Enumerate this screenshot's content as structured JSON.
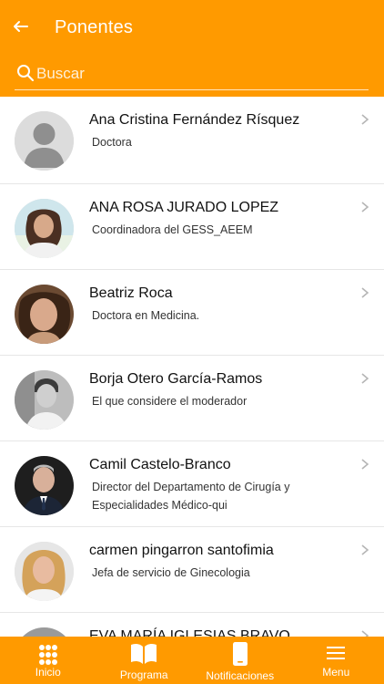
{
  "header": {
    "title": "Ponentes",
    "search_placeholder": "Buscar",
    "color": "#ff9a00"
  },
  "speakers": [
    {
      "name": "Ana Cristina Fernández Rísquez",
      "role": "Doctora",
      "avatar": "default-avatar"
    },
    {
      "name": "ANA ROSA JURADO LOPEZ",
      "role": "Coordinadora del GESS_AEEM",
      "avatar": "photo"
    },
    {
      "name": "Beatriz Roca",
      "role": "Doctora en Medicina.",
      "avatar": "photo"
    },
    {
      "name": "Borja Otero García-Ramos",
      "role": "El que considere el moderador",
      "avatar": "photo"
    },
    {
      "name": "Camil Castelo-Branco",
      "role": "Director del Departamento de Cirugía y Especialidades Médico-qui",
      "avatar": "photo"
    },
    {
      "name": "carmen pingarron santofimia",
      "role": "Jefa de servicio de Ginecologia",
      "avatar": "photo"
    },
    {
      "name": "EVA MARÍA IGLESIAS BRAVO",
      "role": "",
      "avatar": "photo"
    }
  ],
  "tabbar": {
    "tabs": [
      {
        "label": "Inicio",
        "icon": "grid-icon"
      },
      {
        "label": "Programa",
        "icon": "book-icon"
      },
      {
        "label": "Notificaciones",
        "icon": "phone-icon"
      },
      {
        "label": "Menu",
        "icon": "menu-icon"
      }
    ]
  }
}
